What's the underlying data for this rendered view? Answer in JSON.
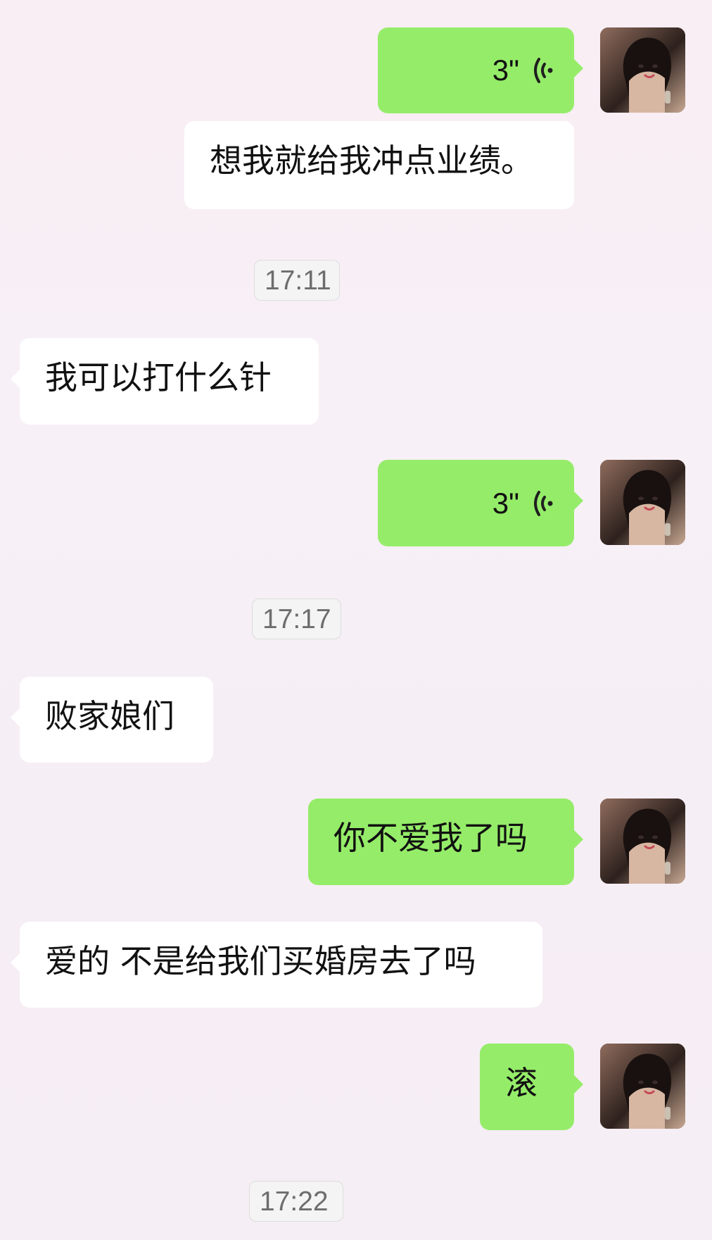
{
  "messages": {
    "m1": {
      "duration": "3\""
    },
    "m2": {
      "text": "想我就给我冲点业绩。"
    },
    "t1": {
      "time": "17:11"
    },
    "m3": {
      "text": "我可以打什么针"
    },
    "m4": {
      "duration": "3\""
    },
    "t2": {
      "time": "17:17"
    },
    "m5": {
      "text": "败家娘们"
    },
    "m6": {
      "text": "你不爱我了吗"
    },
    "m7": {
      "text": "爱的 不是给我们买婚房去了吗"
    },
    "m8": {
      "text": "滚"
    },
    "t3": {
      "time": "17:22"
    }
  },
  "icons": {
    "voice": "voice-icon",
    "avatar": "avatar-photo"
  },
  "colors": {
    "green_bubble": "#95ec69",
    "white_bubble": "#ffffff",
    "background": "#f7f0f6",
    "time_badge": "#f4f4f4"
  }
}
